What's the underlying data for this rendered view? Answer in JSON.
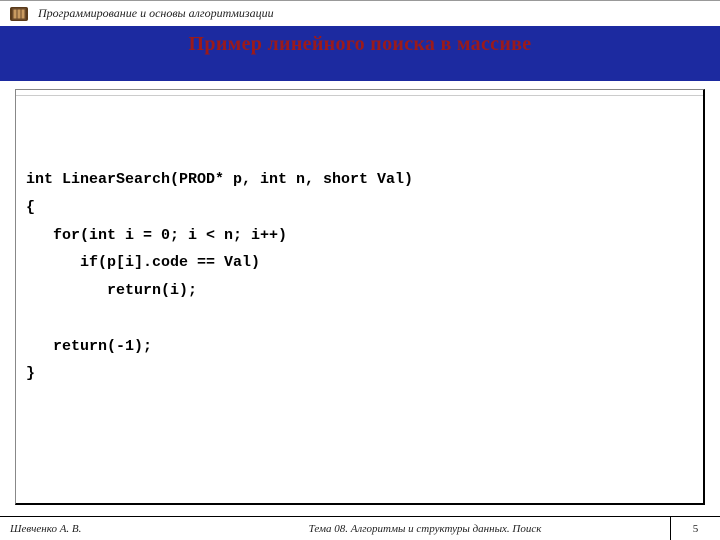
{
  "header": {
    "course_title": "Программирование и основы алгоритмизации"
  },
  "slide": {
    "title": "Пример линейного поиска в массиве"
  },
  "code": {
    "content": "int LinearSearch(PROD* p, int n, short Val)\n{\n   for(int i = 0; i < n; i++)\n      if(p[i].code == Val)\n         return(i);\n\n   return(-1);\n}"
  },
  "footer": {
    "author": "Шевченко А. В.",
    "topic": "Тема 08. Алгоритмы и структуры данных. Поиск",
    "page": "5"
  }
}
